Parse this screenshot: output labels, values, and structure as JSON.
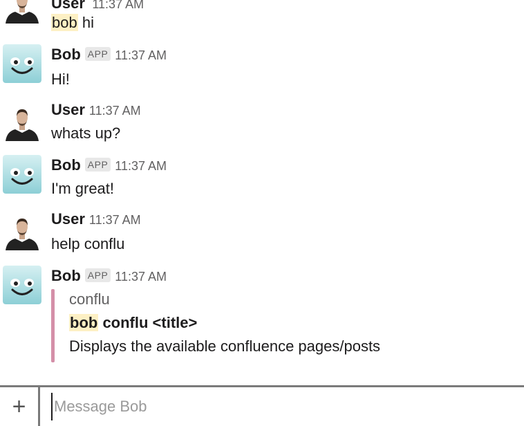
{
  "colors": {
    "mention_bg": "#fdf0c4",
    "quote_bar": "#d48fa8",
    "bot_avatar_bg": "#a8dce0"
  },
  "messages": [
    {
      "author": "User",
      "time": "11:37 AM",
      "mention": "bob",
      "text": " hi",
      "avatar_icon": "user-photo"
    },
    {
      "author": "Bob",
      "badge": "APP",
      "time": "11:37 AM",
      "text": "Hi!",
      "avatar_icon": "smiley-bot"
    },
    {
      "author": "User",
      "time": "11:37 AM",
      "text": "whats up?",
      "avatar_icon": "user-photo"
    },
    {
      "author": "Bob",
      "badge": "APP",
      "time": "11:37 AM",
      "text": "I'm great!",
      "avatar_icon": "smiley-bot"
    },
    {
      "author": "User",
      "time": "11:37 AM",
      "text": "help conflu",
      "avatar_icon": "user-photo"
    },
    {
      "author": "Bob",
      "badge": "APP",
      "time": "11:37 AM",
      "avatar_icon": "smiley-bot",
      "attachment": {
        "title": "conflu",
        "cmd_mention": "bob",
        "cmd_rest": " conflu <title>",
        "description": "Displays the available confluence pages/posts"
      }
    }
  ],
  "composer": {
    "plus_label": "+",
    "placeholder": "Message Bob",
    "value": ""
  }
}
